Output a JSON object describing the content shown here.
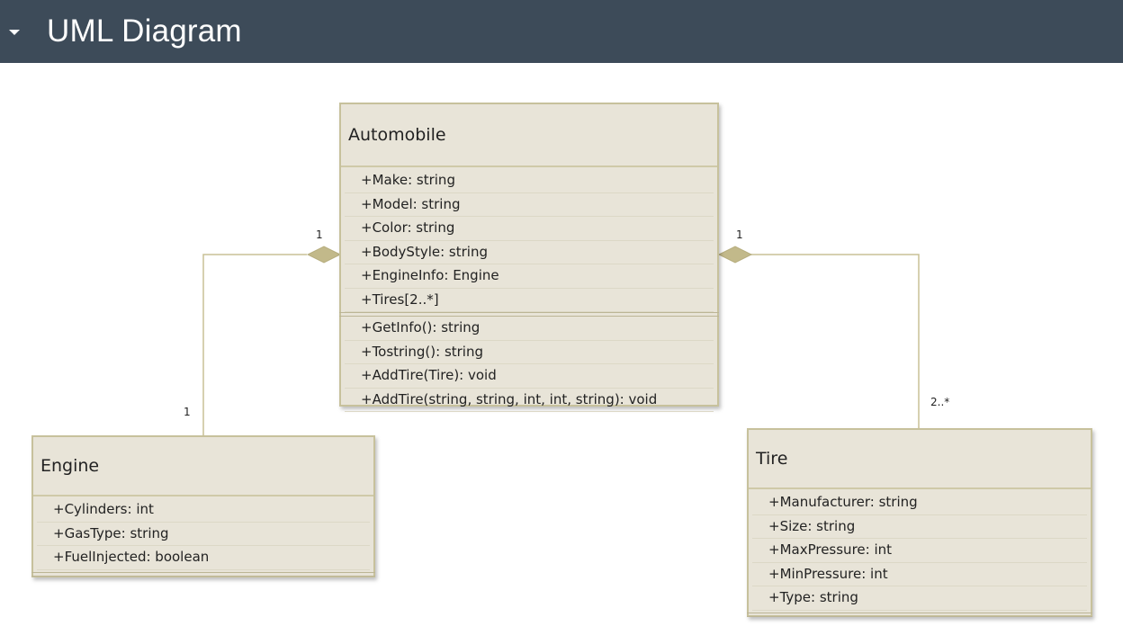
{
  "header": {
    "title": "UML Diagram",
    "caret_icon": "caret-down-icon"
  },
  "classes": {
    "automobile": {
      "name": "Automobile",
      "attributes": [
        "+Make: string",
        "+Model: string",
        "+Color: string",
        "+BodyStyle: string",
        "+EngineInfo: Engine",
        "+Tires[2..*]"
      ],
      "operations": [
        "+GetInfo(): string",
        "+Tostring(): string",
        "+AddTire(Tire): void",
        "+AddTire(string, string, int, int, string): void"
      ]
    },
    "engine": {
      "name": "Engine",
      "attributes": [
        "+Cylinders: int",
        "+GasType: string",
        "+FuelInjected: boolean"
      ]
    },
    "tire": {
      "name": "Tire",
      "attributes": [
        "+Manufacturer: string",
        "+Size: string",
        "+MaxPressure: int",
        "+MinPressure: int",
        "+Type: string"
      ]
    }
  },
  "multiplicities": {
    "auto_engine_side": "1",
    "engine_side": "1",
    "auto_tire_side": "1",
    "tire_side": "2..*"
  },
  "colors": {
    "header_bg": "#3d4b59",
    "box_fill": "#e8e4d8",
    "box_border": "#c7c19c",
    "connector": "#c9c095"
  }
}
